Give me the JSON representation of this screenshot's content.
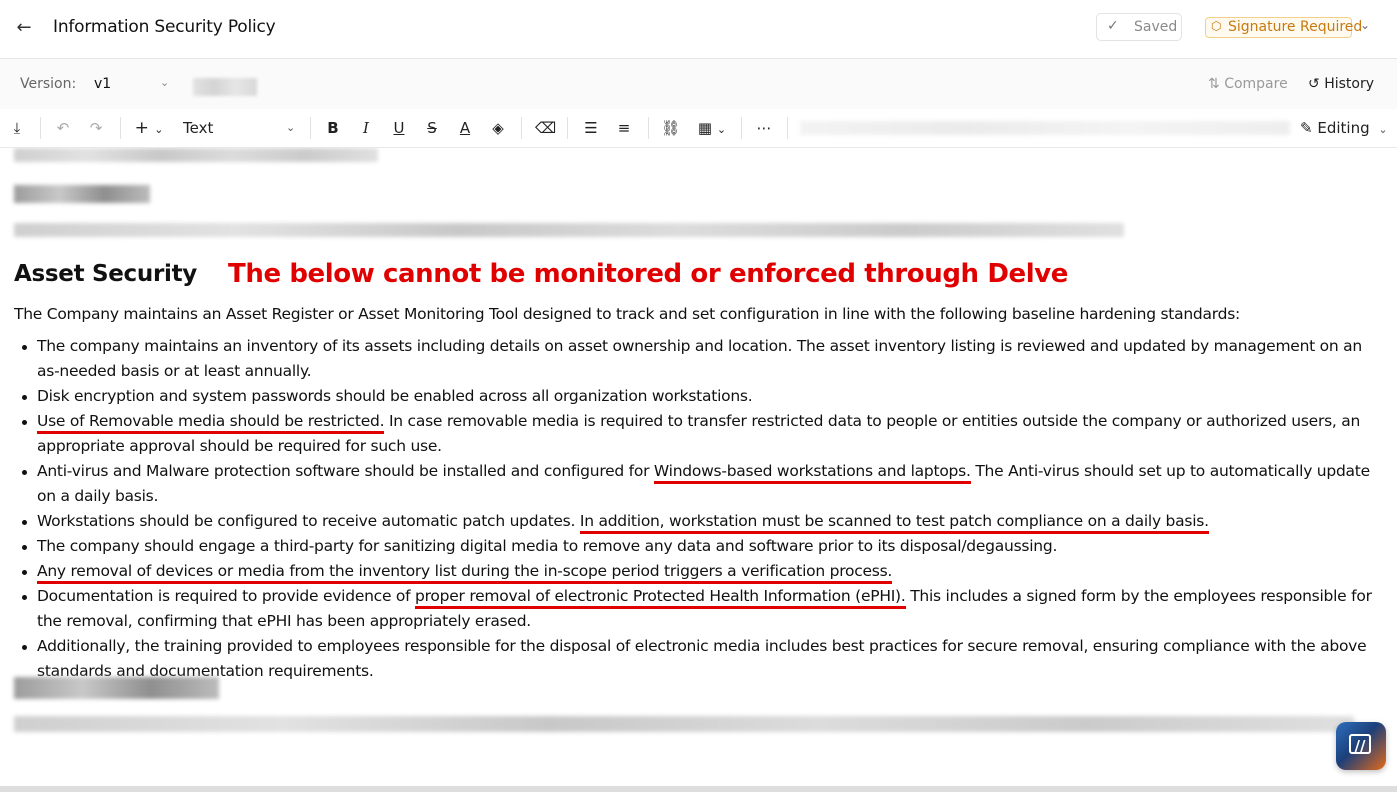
{
  "header": {
    "back_icon": "arrow-left-icon",
    "title": "Information Security Policy",
    "saved_label": "Saved",
    "signature_badge": "Signature Required",
    "signature_color": "#c77a10"
  },
  "version_bar": {
    "version_label": "Version:",
    "version_value": "v1",
    "compare_label": "Compare",
    "history_label": "History"
  },
  "toolbar": {
    "format_value": "Text",
    "editing_label": "Editing"
  },
  "document": {
    "section_title": "Asset Security",
    "annotation": "The below cannot be monitored or enforced through Delve",
    "annotation_color": "#e00000",
    "intro": "The Company maintains an Asset Register or Asset Monitoring Tool designed to track and set configuration in line with the following baseline hardening standards:",
    "bullets": [
      {
        "pre": "The company maintains an inventory of its assets including details on asset ownership and location. The asset inventory listing is reviewed and updated by management on an as-needed basis or at least annually.",
        "hl": "",
        "post": ""
      },
      {
        "pre": "Disk encryption and system passwords should be enabled across all organization workstations.",
        "hl": "",
        "post": ""
      },
      {
        "pre": "",
        "hl": "Use of Removable media should be restricted.",
        "post": " In case removable media is required to transfer restricted data to people or entities outside the company or authorized users, an appropriate approval should be required for such use."
      },
      {
        "pre": "Anti-virus and Malware protection software should be installed and configured for ",
        "hl": "Windows-based workstations and laptops.",
        "post": " The Anti-virus should set up to automatically update on a daily basis."
      },
      {
        "pre": "Workstations should be configured to receive automatic patch updates. ",
        "hl": "In addition, workstation must be scanned to test patch compliance on a daily basis.",
        "post": ""
      },
      {
        "pre": "The company should engage a third-party for sanitizing digital media to remove any data and software prior to its disposal/degaussing.",
        "hl": "",
        "post": ""
      },
      {
        "pre": "",
        "hl": "Any removal of devices or media from the inventory list during the in-scope period triggers a verification process.",
        "post": ""
      },
      {
        "pre": "Documentation is required to provide evidence of ",
        "hl": "proper removal of electronic Protected Health Information (ePHI).",
        "post": " This includes a signed form by the employees responsible for the removal, confirming that ePHI has been appropriately erased."
      },
      {
        "pre": "Additionally, the training provided to employees responsible for the disposal of electronic media includes best practices for secure removal, ensuring compliance with the above standards and documentation requirements.",
        "hl": "",
        "post": ""
      }
    ]
  }
}
